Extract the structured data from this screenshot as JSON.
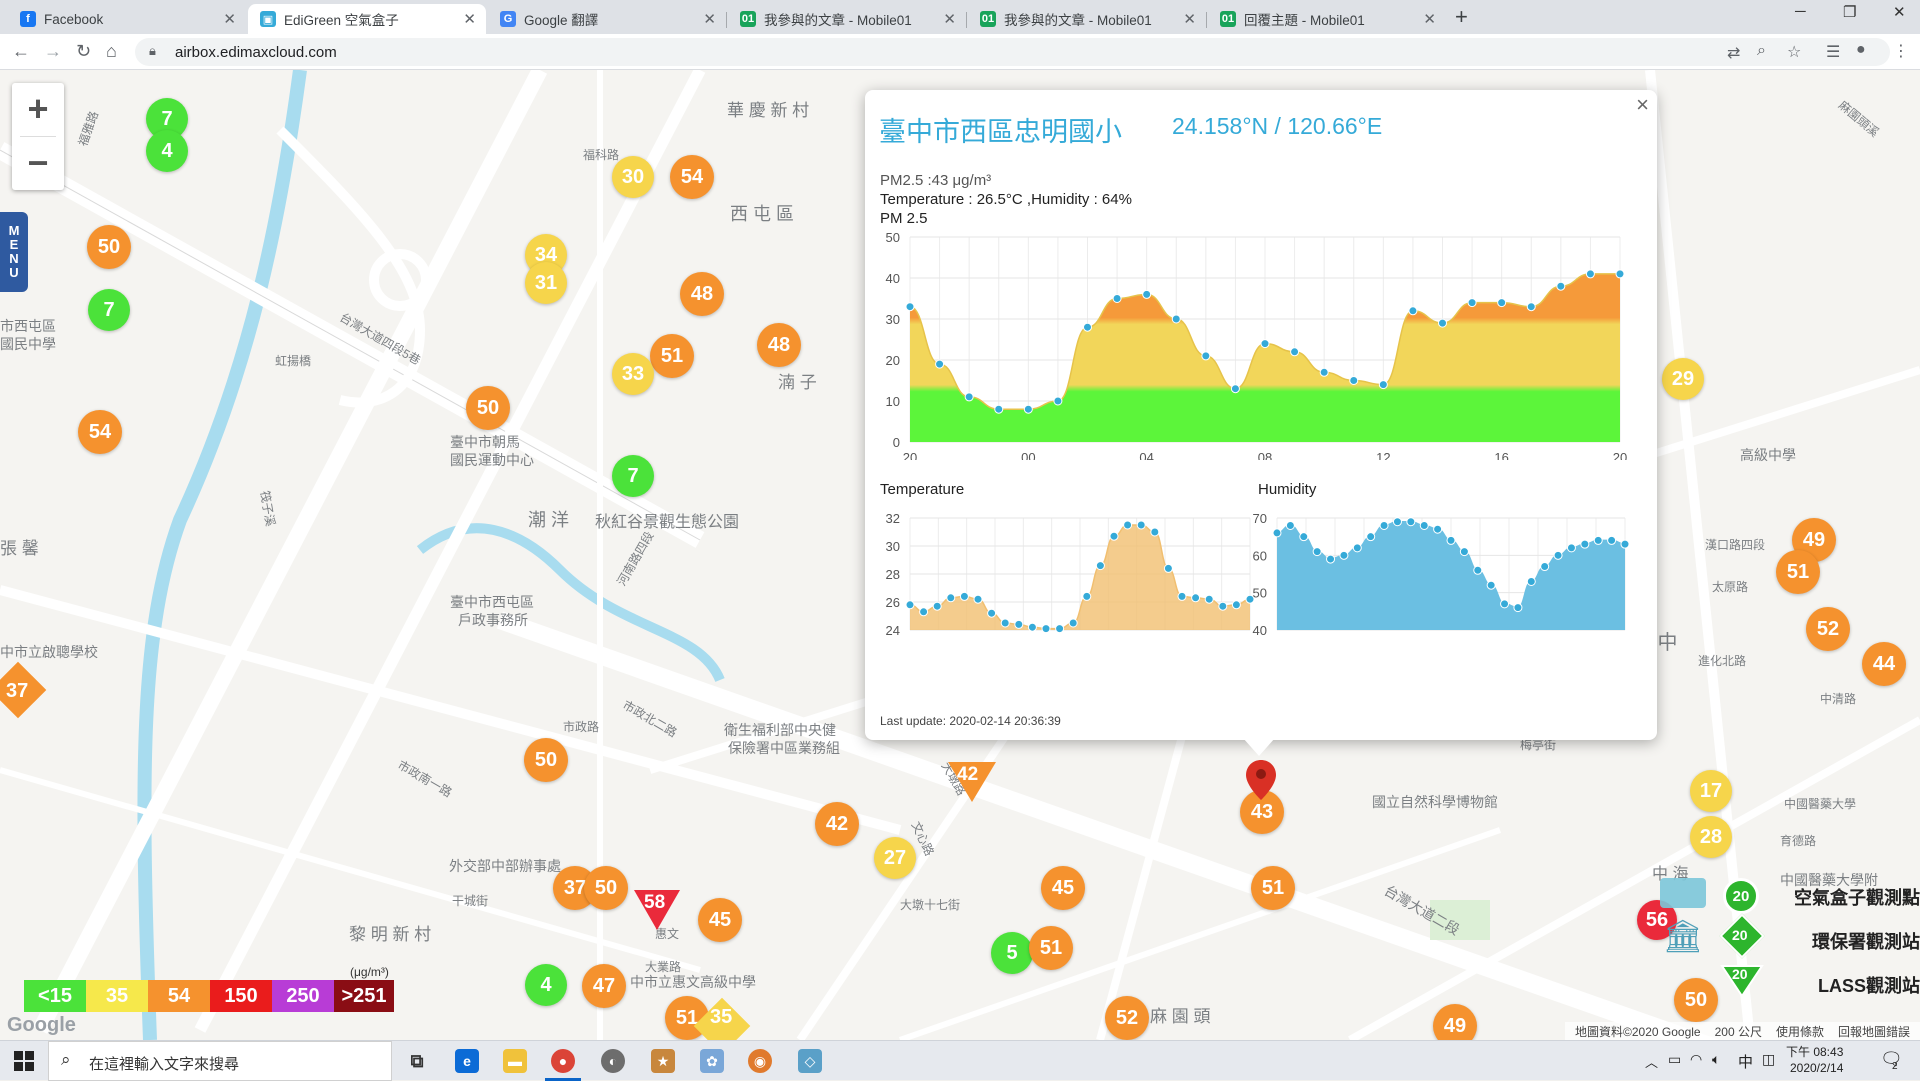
{
  "browser": {
    "tabs": [
      {
        "title": "Facebook",
        "icon": "facebook-icon",
        "color": "#1877f2",
        "active": false
      },
      {
        "title": "EdiGreen 空氣盒子",
        "icon": "edigreen-icon",
        "color": "#35aad8",
        "active": true
      },
      {
        "title": "Google 翻譯",
        "icon": "google-translate-icon",
        "color": "#4285f4",
        "active": false
      },
      {
        "title": "我參與的文章 - Mobile01",
        "icon": "mobile01-icon",
        "color": "#19a35a",
        "active": false
      },
      {
        "title": "我參與的文章 - Mobile01",
        "icon": "mobile01-icon",
        "color": "#19a35a",
        "active": false
      },
      {
        "title": "回覆主題 - Mobile01",
        "icon": "mobile01-icon",
        "color": "#19a35a",
        "active": false
      }
    ],
    "new_tab": "+",
    "url": "airbox.edimaxcloud.com"
  },
  "map": {
    "zoom_in": "+",
    "zoom_out": "−",
    "menu": [
      "M",
      "E",
      "N",
      "U"
    ],
    "labels": [
      {
        "text": "華 慶 新 村",
        "id": "a"
      },
      {
        "text": "西 屯 區",
        "id": "b"
      },
      {
        "text": "湳 子",
        "id": "c"
      },
      {
        "text": "潮 洋",
        "id": "d"
      },
      {
        "text": "秋紅谷景觀生態公園",
        "id": "e"
      },
      {
        "text": "臺中市朝馬",
        "id": "f"
      },
      {
        "text": "國民運動中心",
        "id": "g"
      },
      {
        "text": "臺中市西屯區",
        "id": "h"
      },
      {
        "text": "戶政事務所",
        "id": "i"
      },
      {
        "text": "市西屯區",
        "id": "j"
      },
      {
        "text": "國民中學",
        "id": "k"
      },
      {
        "text": "張 馨",
        "id": "l"
      },
      {
        "text": "中市立啟聰學校",
        "id": "m"
      },
      {
        "text": "衛生福利部中央健",
        "id": "n"
      },
      {
        "text": "保險署中區業務組",
        "id": "o"
      },
      {
        "text": "外交部中部辦事處",
        "id": "p"
      },
      {
        "text": "黎 明 新 村",
        "id": "q"
      },
      {
        "text": "中市立惠文高級中學",
        "id": "r"
      },
      {
        "text": "國立自然科學博物館",
        "id": "s"
      },
      {
        "text": "麻 園 頭",
        "id": "t"
      },
      {
        "text": "臺 中",
        "id": "u"
      },
      {
        "text": "中 海",
        "id": "v"
      },
      {
        "text": "中國醫藥大學附",
        "id": "w"
      },
      {
        "text": "高級中學",
        "id": "x"
      },
      {
        "text": "福科路",
        "id": "y"
      },
      {
        "text": "台灣大道二段",
        "id": "z"
      },
      {
        "text": "惠文",
        "id": "aa"
      },
      {
        "text": "大業路",
        "id": "ab"
      },
      {
        "text": "市政路",
        "id": "ac"
      },
      {
        "text": "文心路",
        "id": "ad"
      },
      {
        "text": "大墩十七街",
        "id": "ae"
      },
      {
        "text": "漢口路四段",
        "id": "af"
      },
      {
        "text": "進化北路",
        "id": "ag"
      },
      {
        "text": "太原路",
        "id": "ah"
      },
      {
        "text": "中清路",
        "id": "ai"
      },
      {
        "text": "梅亭街",
        "id": "aj"
      },
      {
        "text": "育德路",
        "id": "ak"
      },
      {
        "text": "麻園頭溪",
        "id": "al"
      },
      {
        "text": "筏子溪",
        "id": "am"
      },
      {
        "text": "福雅路",
        "id": "an"
      },
      {
        "text": "台灣大道四段5巷",
        "id": "ao"
      },
      {
        "text": "虹揚橋",
        "id": "ap"
      },
      {
        "text": "中國醫藥大學",
        "id": "aq"
      },
      {
        "text": "干城街",
        "id": "ar"
      },
      {
        "text": "大墩路",
        "id": "as"
      },
      {
        "text": "市政北二路",
        "id": "at"
      },
      {
        "text": "市政南一路",
        "id": "au"
      },
      {
        "text": "河南路四段",
        "id": "av"
      }
    ],
    "markers": [
      {
        "v": "7",
        "c": "g"
      },
      {
        "v": "4",
        "c": "g"
      },
      {
        "v": "50",
        "c": "o"
      },
      {
        "v": "7",
        "c": "g"
      },
      {
        "v": "54",
        "c": "o"
      },
      {
        "v": "30",
        "c": "y"
      },
      {
        "v": "54",
        "c": "o"
      },
      {
        "v": "34",
        "c": "y"
      },
      {
        "v": "31",
        "c": "y"
      },
      {
        "v": "48",
        "c": "o"
      },
      {
        "v": "48",
        "c": "o"
      },
      {
        "v": "51",
        "c": "o"
      },
      {
        "v": "33",
        "c": "y"
      },
      {
        "v": "50",
        "c": "o"
      },
      {
        "v": "7",
        "c": "g"
      },
      {
        "v": "29",
        "c": "y"
      },
      {
        "v": "49",
        "c": "o"
      },
      {
        "v": "51",
        "c": "o"
      },
      {
        "v": "52",
        "c": "o"
      },
      {
        "v": "44",
        "c": "o"
      },
      {
        "v": "50",
        "c": "o"
      },
      {
        "v": "42",
        "c": "o"
      },
      {
        "v": "27",
        "c": "y"
      },
      {
        "v": "37",
        "c": "o"
      },
      {
        "v": "50",
        "c": "o"
      },
      {
        "v": "45",
        "c": "o"
      },
      {
        "v": "45",
        "c": "o"
      },
      {
        "v": "51",
        "c": "o"
      },
      {
        "v": "5",
        "c": "g"
      },
      {
        "v": "51",
        "c": "o"
      },
      {
        "v": "4",
        "c": "g"
      },
      {
        "v": "47",
        "c": "o"
      },
      {
        "v": "51",
        "c": "o"
      },
      {
        "v": "52",
        "c": "o"
      },
      {
        "v": "49",
        "c": "o"
      },
      {
        "v": "17",
        "c": "y"
      },
      {
        "v": "28",
        "c": "y"
      },
      {
        "v": "56",
        "c": "r"
      },
      {
        "v": "50",
        "c": "o"
      },
      {
        "v": "43",
        "c": "o"
      }
    ],
    "diamond_37": "37",
    "diamond_35": "35",
    "triangle_42": "42",
    "triangle_58": "58",
    "selected_value": "43",
    "legend_scale": [
      {
        "label": "<15",
        "color": "#4be23a"
      },
      {
        "label": "35",
        "color": "#f6e84b"
      },
      {
        "label": "54",
        "color": "#f5922e"
      },
      {
        "label": "150",
        "color": "#ea1c1c"
      },
      {
        "label": "250",
        "color": "#b83cd6"
      },
      {
        "label": ">251",
        "color": "#8a0d14"
      }
    ],
    "legend_unit": "(μg/m³)",
    "station_legend": [
      {
        "label": "空氣盒子觀測點",
        "badge": "20",
        "icon": "airbox-icon"
      },
      {
        "label": "環保署觀測站",
        "badge": "20",
        "icon": "epa-station-icon"
      },
      {
        "label": "LASS觀測站",
        "badge": "20",
        "icon": "lass-station-icon"
      }
    ],
    "footer": {
      "data": "地圖資料©2020 Google",
      "scale": "200 公尺",
      "terms": "使用條款",
      "report": "回報地圖錯誤"
    },
    "google_logo": "Google"
  },
  "popup": {
    "title": "臺中市西區忠明國小",
    "coords": "24.158°N / 120.66°E",
    "pm_line": "PM2.5 :43 μg/m³",
    "temp_line": "Temperature : 26.5°C ,Humidity : 64%",
    "pm_heading": "PM 2.5",
    "temp_heading": "Temperature",
    "hum_heading": "Humidity",
    "last_update": "Last update: 2020-02-14 20:36:39",
    "close": "×"
  },
  "chart_data": [
    {
      "type": "area",
      "title": "PM 2.5",
      "x_ticks": [
        "20",
        "00",
        "04",
        "08",
        "12",
        "16",
        "20"
      ],
      "ylim": [
        0,
        50
      ],
      "y_ticks": [
        0,
        10,
        20,
        30,
        40,
        50
      ],
      "values": [
        33,
        19,
        11,
        8,
        8,
        10,
        28,
        35,
        36,
        30,
        21,
        13,
        24,
        22,
        17,
        15,
        14,
        32,
        29,
        34,
        34,
        33,
        38,
        41,
        41
      ],
      "grid": true,
      "colors": {
        "good": "#5cf53a",
        "moderate": "#f2d65a",
        "unhealthy": "#f59a3a"
      }
    },
    {
      "type": "area",
      "title": "Temperature",
      "ylim": [
        24,
        32
      ],
      "y_ticks": [
        24,
        26,
        28,
        30,
        32
      ],
      "values": [
        25.8,
        25.3,
        25.7,
        26.3,
        26.4,
        26.2,
        25.2,
        24.5,
        24.4,
        24.2,
        24.1,
        24.1,
        24.5,
        26.4,
        28.6,
        30.7,
        31.5,
        31.5,
        31.0,
        28.4,
        26.4,
        26.3,
        26.2,
        25.7,
        25.8,
        26.2
      ],
      "color": "#f1bf70"
    },
    {
      "type": "area",
      "title": "Humidity",
      "ylim": [
        40,
        70
      ],
      "y_ticks": [
        40,
        50,
        60,
        70
      ],
      "values": [
        66,
        68,
        65,
        61,
        59,
        60,
        62,
        65,
        68,
        69,
        69,
        68,
        67,
        64,
        61,
        56,
        52,
        47,
        46,
        53,
        57,
        60,
        62,
        63,
        64,
        64,
        63
      ],
      "color": "#6bbfe2"
    }
  ],
  "taskbar": {
    "search_placeholder": "在這裡輸入文字來搜尋",
    "time": "下午 08:43",
    "date": "2020/2/14",
    "ime": "中",
    "notifications": "2"
  }
}
